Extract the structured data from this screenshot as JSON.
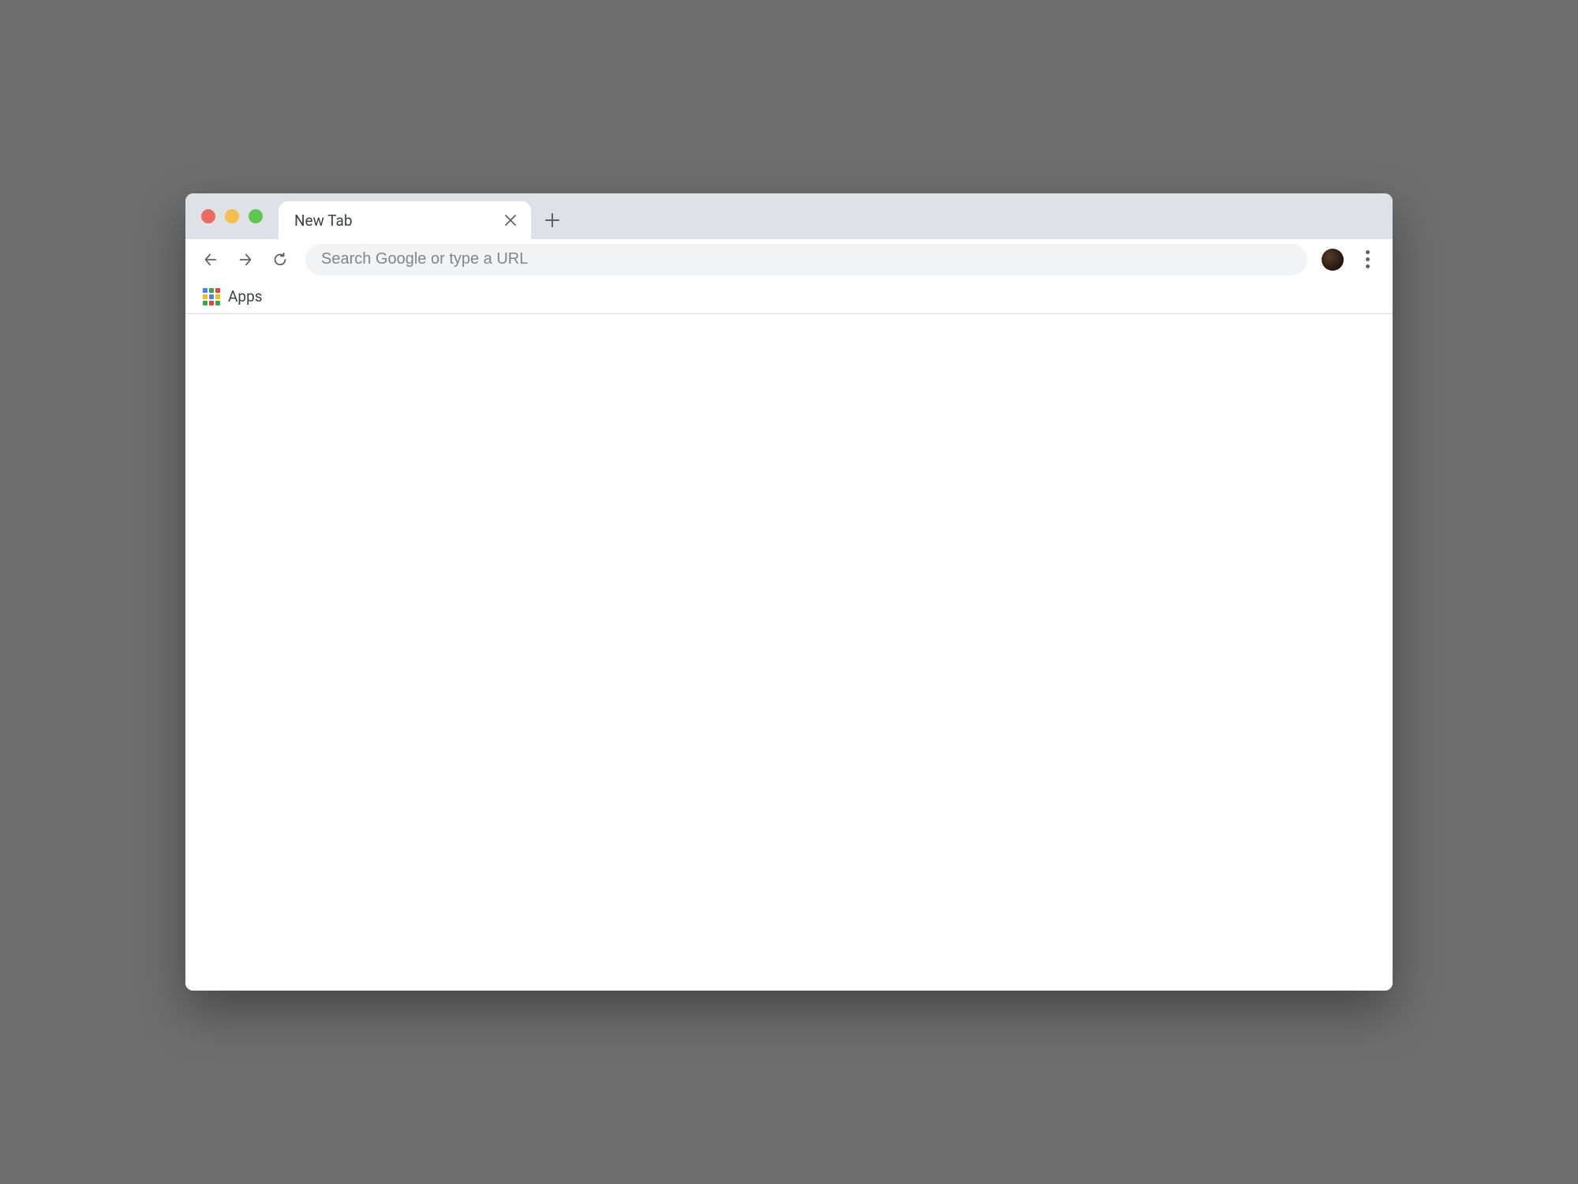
{
  "tab": {
    "title": "New Tab"
  },
  "omnibox": {
    "placeholder": "Search Google or type a URL",
    "value": ""
  },
  "bookmarks": {
    "apps_label": "Apps"
  }
}
